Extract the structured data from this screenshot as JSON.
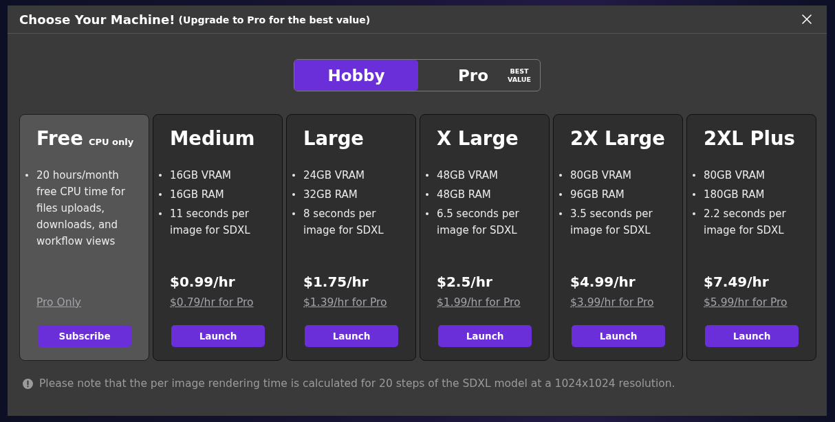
{
  "dialog": {
    "title": "Choose Your Machine!",
    "subtitle": "(Upgrade to Pro for the best value)"
  },
  "plan_toggle": [
    {
      "label": "Hobby",
      "selected": true
    },
    {
      "label": "Pro",
      "badge": "BEST VALUE",
      "selected": false
    }
  ],
  "machines": [
    {
      "name": "Free",
      "name_note": "CPU only",
      "selected": true,
      "features": [
        "20 hours/month free CPU time for files uploads, downloads, and workflow views"
      ],
      "pro_price": "Pro Only",
      "button": "Subscribe"
    },
    {
      "name": "Medium",
      "selected": false,
      "features": [
        "16GB VRAM",
        "16GB RAM",
        "11 seconds per image for SDXL"
      ],
      "price": "$0.99/hr",
      "pro_price": "$0.79/hr for Pro",
      "button": "Launch"
    },
    {
      "name": "Large",
      "selected": false,
      "features": [
        "24GB VRAM",
        "32GB RAM",
        "8 seconds per image for SDXL"
      ],
      "price": "$1.75/hr",
      "pro_price": "$1.39/hr for Pro",
      "button": "Launch"
    },
    {
      "name": "X Large",
      "selected": false,
      "features": [
        "48GB VRAM",
        "48GB RAM",
        "6.5 seconds per image for SDXL"
      ],
      "price": "$2.5/hr",
      "pro_price": "$1.99/hr for Pro",
      "button": "Launch"
    },
    {
      "name": "2X Large",
      "selected": false,
      "features": [
        "80GB VRAM",
        "96GB RAM",
        "3.5 seconds per image for SDXL"
      ],
      "price": "$4.99/hr",
      "pro_price": "$3.99/hr for Pro",
      "button": "Launch"
    },
    {
      "name": "2XL Plus",
      "selected": false,
      "features": [
        "80GB VRAM",
        "180GB RAM",
        "2.2 seconds per image for SDXL"
      ],
      "price": "$7.49/hr",
      "pro_price": "$5.99/hr for Pro",
      "button": "Launch"
    }
  ],
  "note": "Please note that the per image rendering time is calculated for 20 steps of the SDXL model at a 1024x1024 resolution."
}
